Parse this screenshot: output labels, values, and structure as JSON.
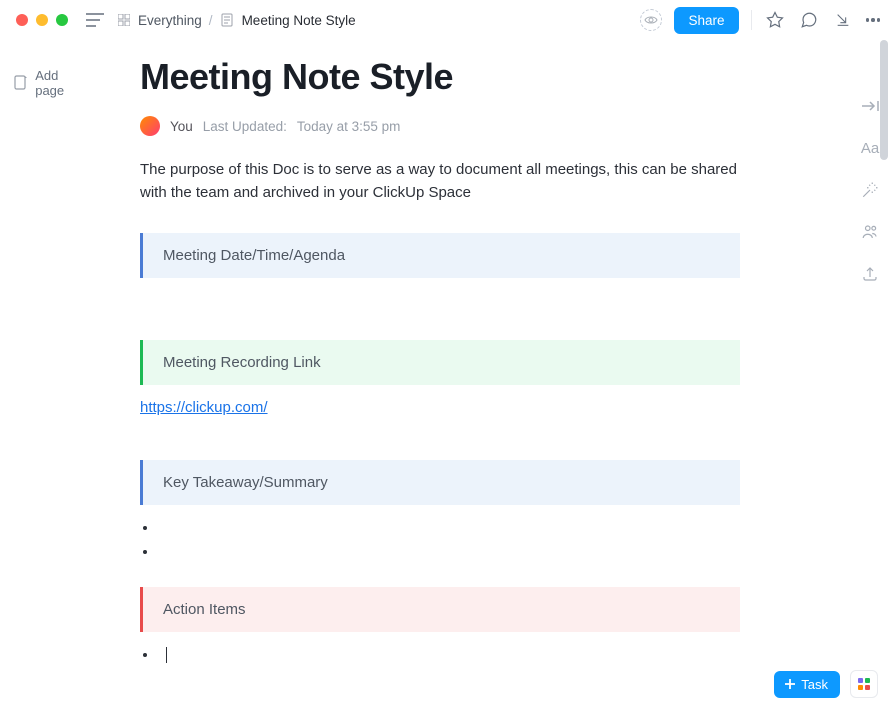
{
  "topbar": {
    "breadcrumbs": {
      "root": "Everything",
      "current": "Meeting Note Style"
    },
    "share_label": "Share"
  },
  "sidebar": {
    "add_page": "Add page"
  },
  "doc": {
    "title": "Meeting Note Style",
    "author_label": "You",
    "updated_label": "Last Updated:",
    "updated_value": "Today at 3:55 pm",
    "intro": "The purpose of this Doc is to serve as a way to document all meetings, this can be shared with the team and archived in your ClickUp Space",
    "callouts": {
      "meeting_info": "Meeting Date/Time/Agenda",
      "recording": "Meeting Recording Link",
      "takeaway": "Key Takeaway/Summary",
      "actions": "Action Items"
    },
    "link": "https://clickup.com/"
  },
  "footer": {
    "task_label": "Task"
  }
}
